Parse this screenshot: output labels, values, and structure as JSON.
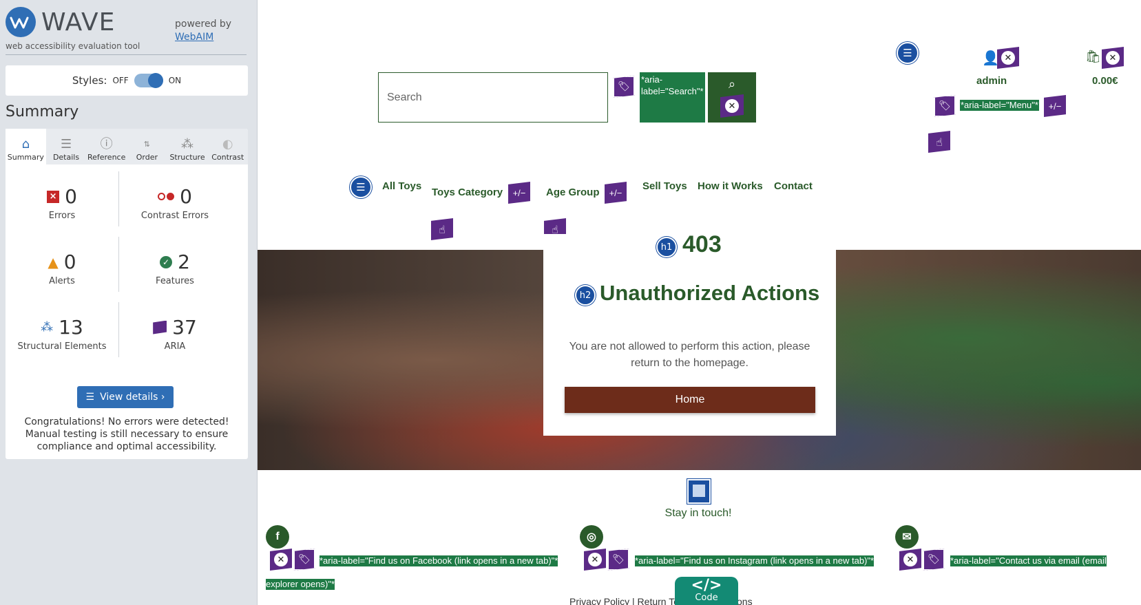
{
  "wave": {
    "logo_word": "WAVE",
    "logo_sub": "web accessibility evaluation tool",
    "powered_by": "powered by",
    "webaim_link": "WebAIM",
    "styles_label": "Styles:",
    "styles_off": "OFF",
    "styles_on": "ON",
    "summary_title": "Summary",
    "tabs": [
      {
        "label": "Summary",
        "icon": "home-icon"
      },
      {
        "label": "Details",
        "icon": "list-icon"
      },
      {
        "label": "Reference",
        "icon": "info-icon"
      },
      {
        "label": "Order",
        "icon": "order-icon"
      },
      {
        "label": "Structure",
        "icon": "structure-icon"
      },
      {
        "label": "Contrast",
        "icon": "contrast-icon"
      }
    ],
    "stats": {
      "errors": {
        "value": "0",
        "label": "Errors"
      },
      "contrast_errors": {
        "value": "0",
        "label": "Contrast Errors"
      },
      "alerts": {
        "value": "0",
        "label": "Alerts"
      },
      "features": {
        "value": "2",
        "label": "Features"
      },
      "structural": {
        "value": "13",
        "label": "Structural Elements"
      },
      "aria": {
        "value": "37",
        "label": "ARIA"
      }
    },
    "view_details": "View details ›",
    "congrats": "Congratulations! No errors were detected! Manual testing is still necessary to ensure compliance and optimal accessibility."
  },
  "page": {
    "search_placeholder": "Search",
    "search_aria": "*aria-label=\"Search\"*",
    "menu_aria": "*aria-label=\"Menu\"*",
    "admin": "admin",
    "cart_total": "0.00€",
    "nav": [
      "All Toys",
      "Toys Category",
      "Age Group",
      "Sell Toys",
      "How it Works",
      "Contact"
    ],
    "badges": {
      "plus_minus": "+/−",
      "h1": "h1",
      "h2": "h2"
    },
    "h1": "403",
    "h2": "Unauthorized Actions",
    "message": "You are not allowed to perform this action, please return to the homepage.",
    "home_button": "Home",
    "stay_in_touch": "Stay in touch!",
    "social": {
      "facebook_icon": "f",
      "facebook_aria": "*aria-label=\"Find us on Facebook (link opens in a new tab)\"*",
      "instagram_aria": "*aria-label=\"Find us on Instagram (link opens in a new tab)\"*",
      "email_aria_line1": "*aria-label=\"Contact us via email (email",
      "email_aria_line2": "explorer opens)\"*"
    },
    "footer_links": "Privacy Policy | Return          Terms & Conditions",
    "code_tab": {
      "symbol": "</>",
      "label": "Code"
    }
  },
  "colors": {
    "wave_blue": "#2f6eb5",
    "aria_purple": "#5b2a86",
    "aria_green": "#1e7a45",
    "site_green": "#2a5a2a",
    "home_button": "#6d2c1a"
  }
}
